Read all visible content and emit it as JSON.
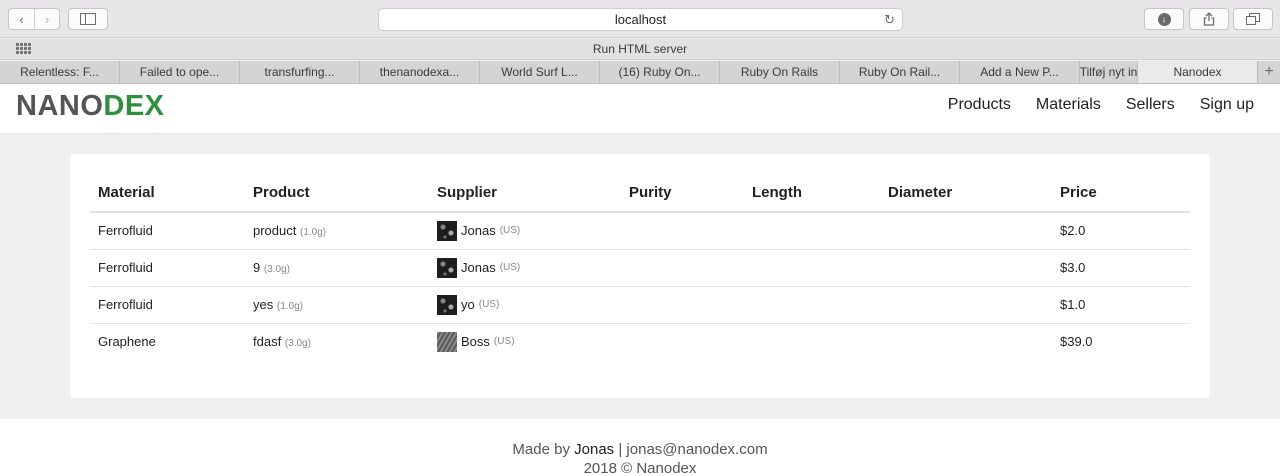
{
  "browser": {
    "url": "localhost",
    "favorites_title": "Run HTML server",
    "tabs": [
      {
        "label": "Relentless: F..."
      },
      {
        "label": "Failed to ope..."
      },
      {
        "label": "transfurfing..."
      },
      {
        "label": "thenanodexa..."
      },
      {
        "label": "World Surf L..."
      },
      {
        "label": "(16) Ruby On..."
      },
      {
        "label": "Ruby On Rails"
      },
      {
        "label": "Ruby On Rail..."
      },
      {
        "label": "Add a New P..."
      },
      {
        "label": "Tilføj nyt in"
      },
      {
        "label": "Nanodex"
      }
    ],
    "plus_label": "+"
  },
  "site": {
    "logo_part1": "NANO",
    "logo_part2": "DEX",
    "nav": [
      "Products",
      "Materials",
      "Sellers",
      "Sign up"
    ]
  },
  "table": {
    "headers": [
      "Material",
      "Product",
      "Supplier",
      "Purity",
      "Length",
      "Diameter",
      "Price"
    ],
    "rows": [
      {
        "material": "Ferrofluid",
        "product": "product",
        "weight": "(1.0g)",
        "supplier": "Jonas",
        "country": "(US)",
        "purity": "",
        "length": "",
        "diameter": "",
        "price": "$2.0"
      },
      {
        "material": "Ferrofluid",
        "product": "9",
        "weight": "(3.0g)",
        "supplier": "Jonas",
        "country": "(US)",
        "purity": "",
        "length": "",
        "diameter": "",
        "price": "$3.0"
      },
      {
        "material": "Ferrofluid",
        "product": "yes",
        "weight": "(1.0g)",
        "supplier": "yo",
        "country": "(US)",
        "purity": "",
        "length": "",
        "diameter": "",
        "price": "$1.0"
      },
      {
        "material": "Graphene",
        "product": "fdasf",
        "weight": "(3.0g)",
        "supplier": "Boss",
        "country": "(US)",
        "purity": "",
        "length": "",
        "diameter": "",
        "price": "$39.0"
      }
    ]
  },
  "footer": {
    "made_by_prefix": "Made by",
    "author": "Jonas",
    "separator": "|",
    "email": "jonas@nanodex.com",
    "copyright": "2018 © Nanodex"
  }
}
